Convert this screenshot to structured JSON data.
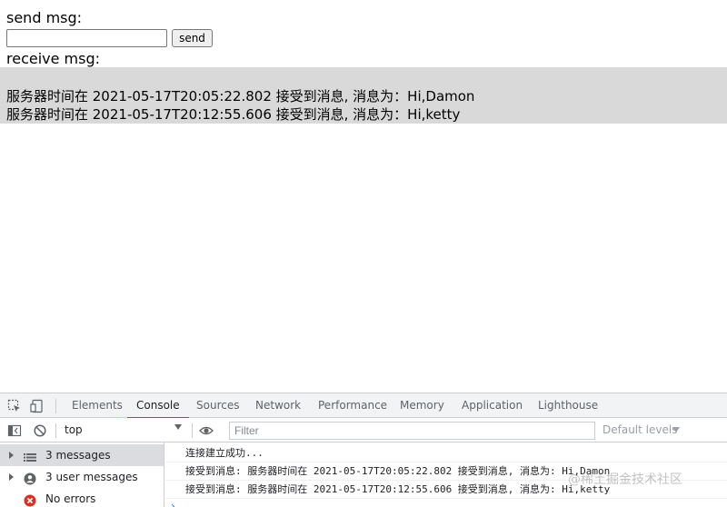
{
  "page": {
    "send_heading": "send msg:",
    "input_value": "",
    "send_button": "send",
    "receive_heading": "receive msg:",
    "received": [
      "服务器时间在 2021-05-17T20:05:22.802 接受到消息, 消息为：Hi,Damon",
      "服务器时间在 2021-05-17T20:12:55.606 接受到消息, 消息为：Hi,ketty"
    ]
  },
  "devtools": {
    "tabs": [
      {
        "label": "Elements",
        "active": false
      },
      {
        "label": "Console",
        "active": true
      },
      {
        "label": "Sources",
        "active": false
      },
      {
        "label": "Network",
        "active": false
      },
      {
        "label": "Performance",
        "active": false
      },
      {
        "label": "Memory",
        "active": false
      },
      {
        "label": "Application",
        "active": false
      },
      {
        "label": "Lighthouse",
        "active": false
      }
    ],
    "context": "top",
    "filter_placeholder": "Filter",
    "levels": "Default levels",
    "sidebar": [
      {
        "label": "3 messages",
        "icon": "list-icon",
        "selected": true
      },
      {
        "label": "3 user messages",
        "icon": "user-icon",
        "selected": false
      },
      {
        "label": "No errors",
        "icon": "error-icon",
        "selected": false
      }
    ],
    "logs": [
      "连接建立成功...",
      "接受到消息: 服务器时间在 2021-05-17T20:05:22.802 接受到消息, 消息为: Hi,Damon",
      "接受到消息: 服务器时间在 2021-05-17T20:12:55.606 接受到消息, 消息为: Hi,ketty"
    ],
    "prompt": "›"
  },
  "watermark": "@稀土掘金技术社区",
  "colors": {
    "accent": "#1a73e8",
    "error": "#d93025",
    "receive_bg": "#d9d9d9"
  }
}
